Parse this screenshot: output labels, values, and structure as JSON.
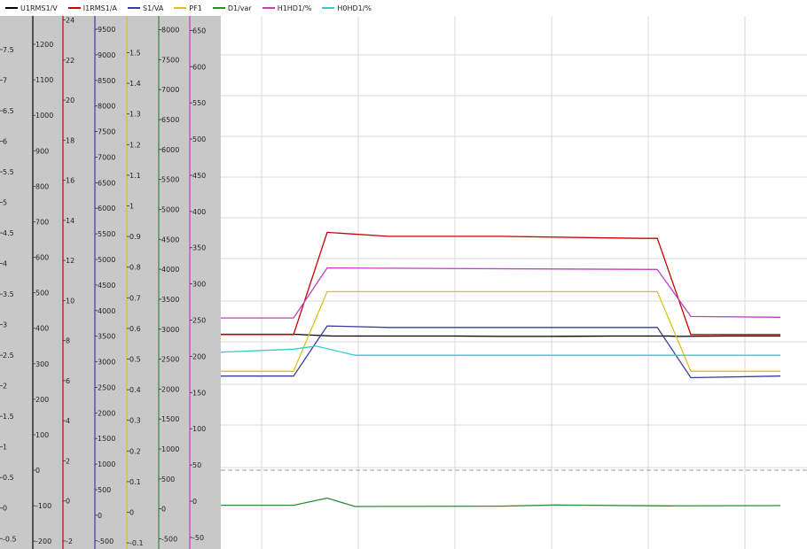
{
  "chart_data": {
    "type": "line",
    "title": "",
    "xlabel": "",
    "grid": true,
    "legend_position": "top-left",
    "series": [
      {
        "name": "U1RMS1/V",
        "color": "#000000",
        "axis_ticks": [
          -200,
          -100,
          0,
          100,
          200,
          300,
          400,
          500,
          600,
          700,
          800,
          900,
          1000,
          1100,
          1200
        ],
        "ylim": [
          -222,
          1280
        ],
        "values": [
          [
            0,
            383
          ],
          [
            0.13,
            383
          ],
          [
            0.2,
            378
          ],
          [
            0.3,
            378
          ],
          [
            0.42,
            378
          ],
          [
            0.5,
            377
          ],
          [
            0.58,
            377
          ],
          [
            0.7,
            378
          ],
          [
            0.8,
            378
          ],
          [
            0.82,
            377
          ],
          [
            0.9,
            378
          ],
          [
            1,
            378
          ]
        ]
      },
      {
        "name": "I1RMS1/A",
        "color": "#cc0000",
        "axis_ticks": [
          -2,
          0,
          2,
          4,
          6,
          8,
          10,
          12,
          14,
          16,
          18,
          20,
          22,
          24
        ],
        "ylim": [
          -2.4,
          24.2
        ],
        "values": [
          [
            0,
            8.3
          ],
          [
            0.13,
            8.3
          ],
          [
            0.19,
            13.4
          ],
          [
            0.3,
            13.2
          ],
          [
            0.5,
            13.2
          ],
          [
            0.75,
            13.1
          ],
          [
            0.78,
            13.1
          ],
          [
            0.84,
            8.3
          ],
          [
            1,
            8.3
          ]
        ]
      },
      {
        "name": "S1/VA",
        "color": "#3b3b9e",
        "axis_ticks": [
          -500,
          0,
          500,
          1000,
          1500,
          2000,
          2500,
          3000,
          3500,
          4000,
          4500,
          5000,
          5500,
          6000,
          6500,
          7000,
          7500,
          8000,
          8500,
          9000,
          9500
        ],
        "ylim": [
          -660,
          9760
        ],
        "values": [
          [
            0,
            2720
          ],
          [
            0.13,
            2720
          ],
          [
            0.19,
            3700
          ],
          [
            0.3,
            3670
          ],
          [
            0.5,
            3670
          ],
          [
            0.78,
            3670
          ],
          [
            0.84,
            2690
          ],
          [
            1,
            2720
          ]
        ]
      },
      {
        "name": "PF1",
        "color": "#e0c020",
        "axis_ticks": [
          -0.1,
          0,
          0.1,
          0.2,
          0.3,
          0.4,
          0.5,
          0.6,
          0.7,
          0.8,
          0.9,
          1,
          1.1,
          1.2,
          1.3,
          1.4,
          1.5
        ],
        "ylim": [
          -0.12,
          1.62
        ],
        "values": [
          [
            0,
            0.46
          ],
          [
            0.13,
            0.46
          ],
          [
            0.19,
            0.72
          ],
          [
            0.78,
            0.72
          ],
          [
            0.84,
            0.46
          ],
          [
            1,
            0.46
          ]
        ]
      },
      {
        "name": "D1/var",
        "color": "#2e8b2e",
        "axis_ticks": [
          -500,
          0,
          500,
          1000,
          1500,
          2000,
          2500,
          3000,
          3500,
          4000,
          4500,
          5000,
          5500,
          6000,
          6500,
          7000,
          7500,
          8000
        ],
        "ylim": [
          -670,
          8230
        ],
        "values": [
          [
            0,
            60
          ],
          [
            0.13,
            60
          ],
          [
            0.19,
            180
          ],
          [
            0.24,
            40
          ],
          [
            0.5,
            45
          ],
          [
            0.6,
            65
          ],
          [
            0.8,
            50
          ],
          [
            1,
            55
          ]
        ]
      },
      {
        "name": "H1HD1/%",
        "color": "#c040c0",
        "axis_ticks": [
          -50,
          0,
          50,
          100,
          150,
          200,
          250,
          300,
          350,
          400,
          450,
          500,
          550,
          600,
          650
        ],
        "ylim": [
          -66,
          670
        ],
        "values": [
          [
            0,
            253
          ],
          [
            0.13,
            253
          ],
          [
            0.19,
            322
          ],
          [
            0.78,
            320
          ],
          [
            0.84,
            255
          ],
          [
            1,
            254
          ]
        ]
      },
      {
        "name": "H0HD1/%",
        "color": "#33cccc",
        "axis_ticks": [
          -0.5,
          0,
          0.5,
          1,
          1.5,
          2,
          2.5,
          3,
          3.5,
          4,
          4.5,
          5,
          5.5,
          6,
          6.5,
          7,
          7.5
        ],
        "ylim": [
          -0.67,
          8.05
        ],
        "values": [
          [
            0,
            2.55
          ],
          [
            0.13,
            2.6
          ],
          [
            0.17,
            2.65
          ],
          [
            0.24,
            2.5
          ],
          [
            1,
            2.5
          ]
        ]
      }
    ],
    "reference_line": 0
  }
}
